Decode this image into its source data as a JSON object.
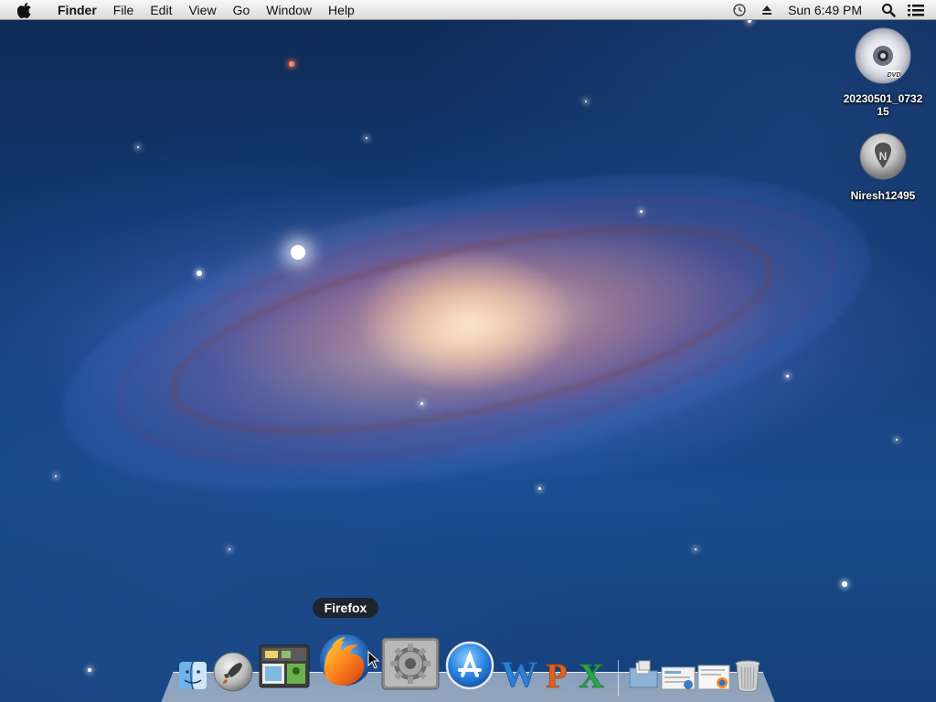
{
  "menubar": {
    "app_name": "Finder",
    "items": [
      "File",
      "Edit",
      "View",
      "Go",
      "Window",
      "Help"
    ],
    "clock": "Sun 6:49 PM",
    "status_icons": [
      "time-machine-icon",
      "eject-icon",
      "spotlight-search-icon",
      "notification-list-icon"
    ]
  },
  "desktop_icons": [
    {
      "label": "20230501_073215",
      "icon": "dvd-disc-icon"
    },
    {
      "label": "Niresh12495",
      "icon": "niresh-disk-icon"
    }
  ],
  "dock": {
    "tooltip": "Firefox",
    "apps": [
      {
        "name": "Finder",
        "icon": "finder-icon"
      },
      {
        "name": "Launchpad",
        "icon": "launchpad-rocket-icon"
      },
      {
        "name": "Photo Booth",
        "icon": "photo-booth-icon"
      },
      {
        "name": "Firefox",
        "icon": "firefox-icon"
      },
      {
        "name": "System Preferences",
        "icon": "system-preferences-gear-icon"
      },
      {
        "name": "App Store",
        "icon": "app-store-icon"
      },
      {
        "name": "Word",
        "icon": "word-icon",
        "letter": "W"
      },
      {
        "name": "PowerPoint",
        "icon": "powerpoint-icon",
        "letter": "P"
      },
      {
        "name": "Excel",
        "icon": "excel-icon",
        "letter": "X"
      }
    ],
    "stacks": [
      {
        "name": "Applications",
        "icon": "applications-folder-icon"
      },
      {
        "name": "Document",
        "icon": "document-stack-icon"
      },
      {
        "name": "Downloads",
        "icon": "downloads-stack-icon"
      },
      {
        "name": "Trash",
        "icon": "trash-icon"
      }
    ]
  },
  "colors": {
    "word": "#2b7fd4",
    "powerpoint": "#e0621e",
    "excel": "#2aa44a",
    "tooltip_bg": "#1e1e1e"
  }
}
